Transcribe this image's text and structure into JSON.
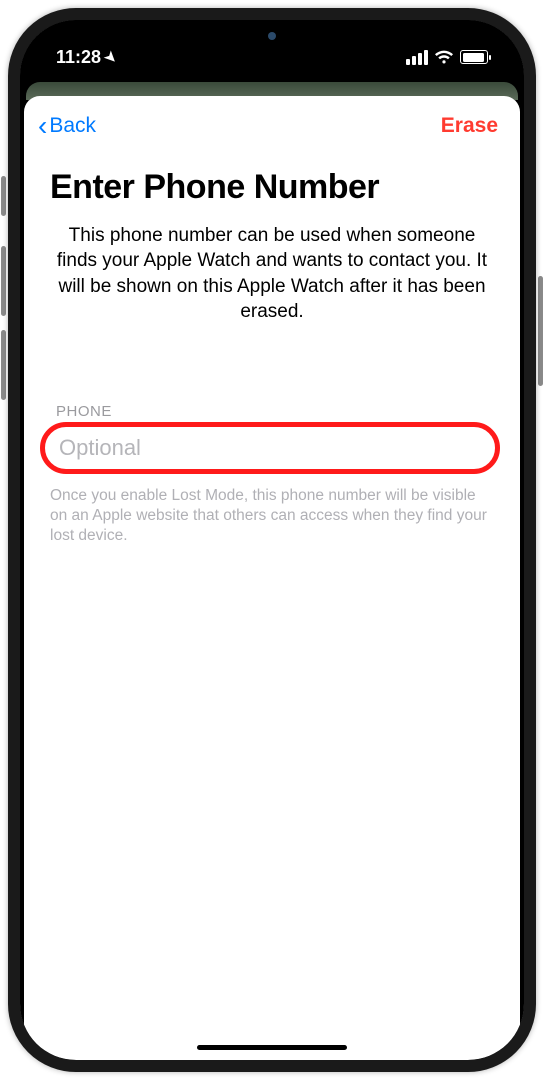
{
  "status": {
    "time": "11:28",
    "location_arrow": "➤"
  },
  "nav": {
    "back_label": "Back",
    "erase_label": "Erase"
  },
  "page": {
    "title": "Enter Phone Number",
    "description": "This phone number can be used when someone finds your Apple Watch and wants to contact you. It will be shown on this Apple Watch after it has been erased."
  },
  "field": {
    "label": "PHONE",
    "placeholder": "Optional",
    "value": "",
    "hint": "Once you enable Lost Mode, this phone number will be visible on an Apple website that others can access when they find your lost device."
  }
}
